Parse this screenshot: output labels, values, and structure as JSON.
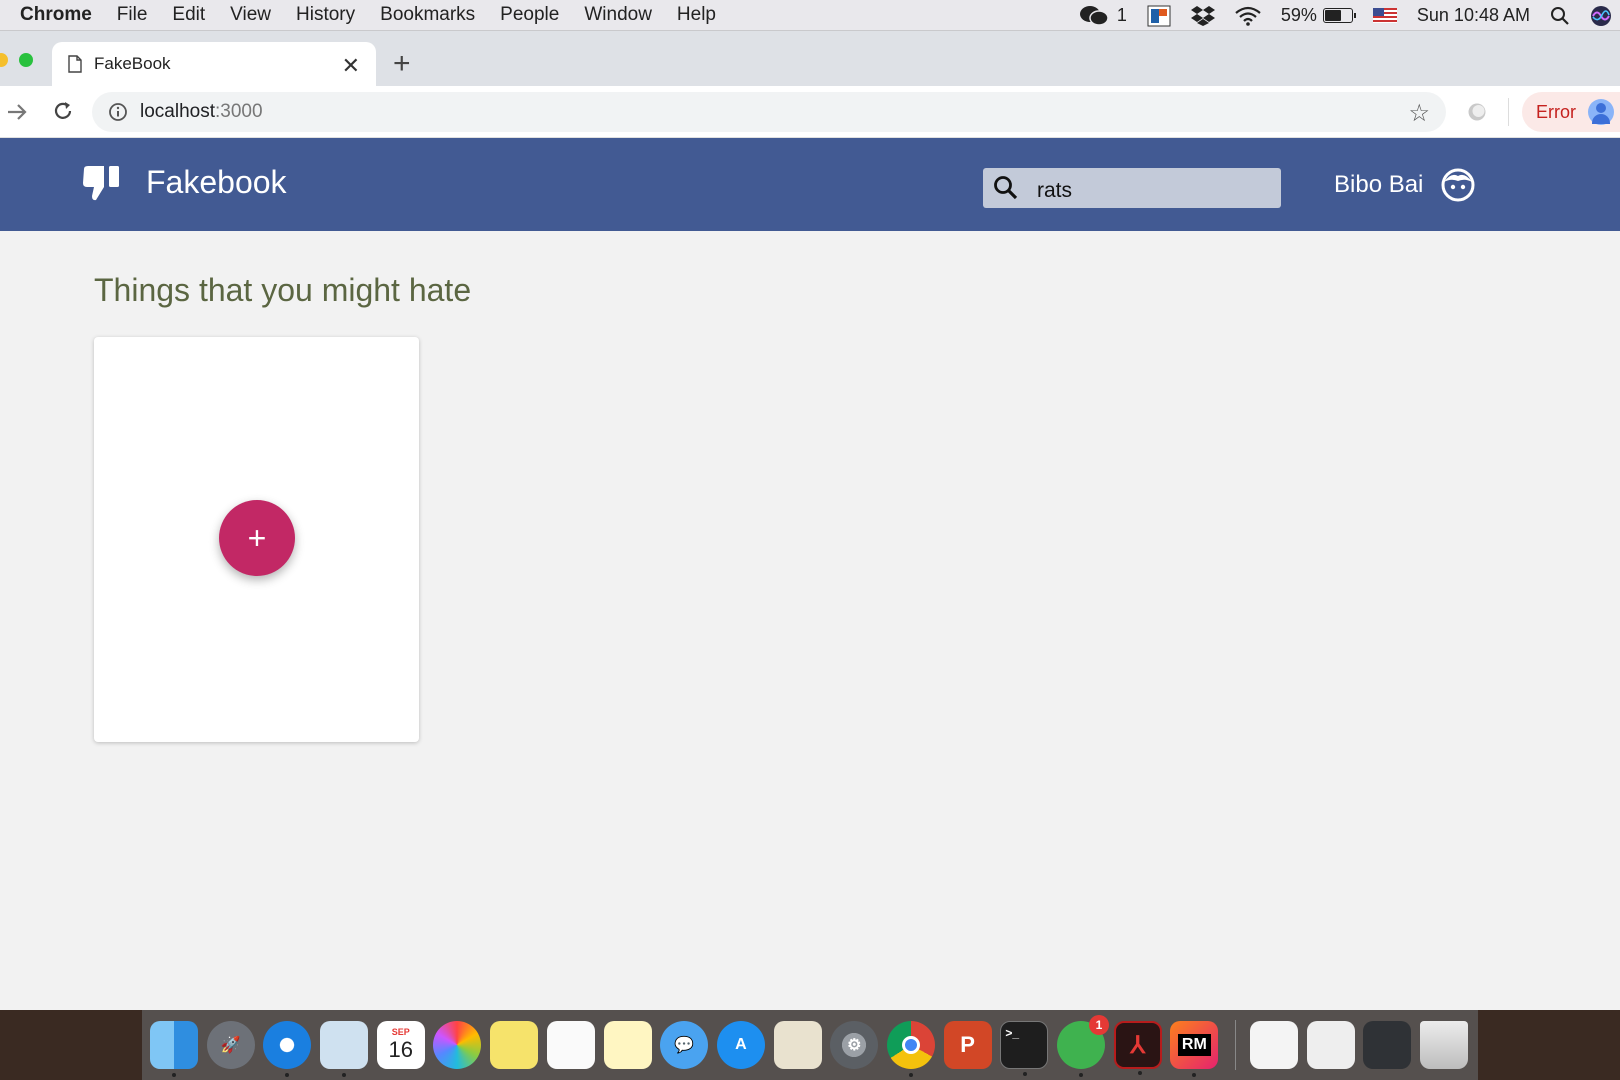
{
  "menubar": {
    "app": "Chrome",
    "menus": [
      "File",
      "Edit",
      "View",
      "History",
      "Bookmarks",
      "People",
      "Window",
      "Help"
    ],
    "wechat_count": "1",
    "battery_pct": "59%",
    "battery_level": 0.59,
    "clock": "Sun 10:48 AM"
  },
  "browser": {
    "tab_title": "FakeBook",
    "url_host": "localhost",
    "url_port": ":3000",
    "profile_status": "Error"
  },
  "app": {
    "brand": "Fakebook",
    "search_value": "rats",
    "user_name": "Bibo Bai",
    "header_color": "#425a93"
  },
  "content": {
    "heading": "Things that you might hate",
    "add_label": "+",
    "fab_color": "#c22865"
  },
  "dock": {
    "calendar_month": "SEP",
    "calendar_day": "16",
    "wechat_badge": "1",
    "rubymine_label": "RM",
    "powerpoint_label": "P",
    "terminal_label": ">_"
  }
}
